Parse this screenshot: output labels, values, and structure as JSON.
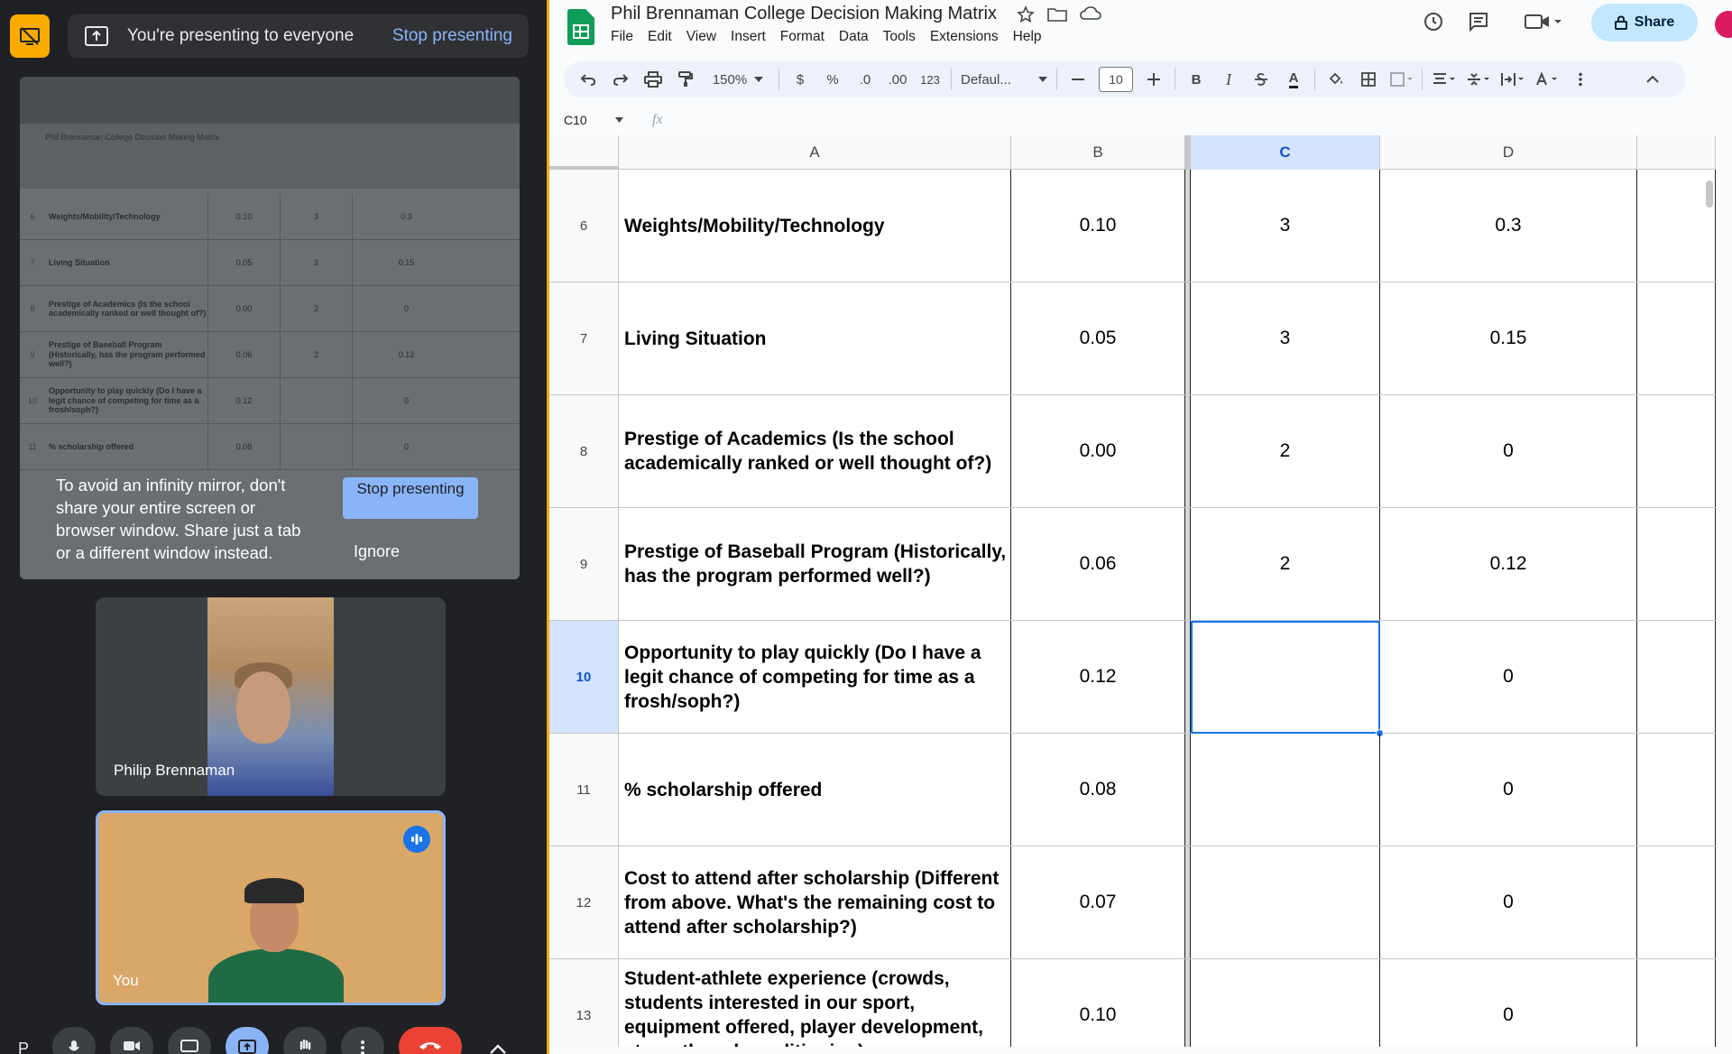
{
  "meet": {
    "banner_text": "You're presenting to everyone",
    "stop_link": "Stop presenting",
    "mirror": {
      "title": "Phil Brennaman College Decision Making Matrix",
      "rows": [
        {
          "num": "6",
          "a": "Weights/Mobility/Technology",
          "b": "0.10",
          "c": "3",
          "d": "0.3"
        },
        {
          "num": "7",
          "a": "Living Situation",
          "b": "0.05",
          "c": "3",
          "d": "0.15"
        },
        {
          "num": "8",
          "a": "Prestige of Academics (Is the school academically ranked or well thought of?)",
          "b": "0.00",
          "c": "2",
          "d": "0"
        },
        {
          "num": "9",
          "a": "Prestige of Baseball Program (Historically, has the program performed well?)",
          "b": "0.06",
          "c": "2",
          "d": "0.12"
        },
        {
          "num": "10",
          "a": "Opportunity to play quickly (Do I have a legit chance of competing for time as a frosh/soph?)",
          "b": "0.12",
          "c": "",
          "d": "0"
        },
        {
          "num": "11",
          "a": "% scholarship offered",
          "b": "0.08",
          "c": "",
          "d": "0"
        }
      ],
      "warning": "To avoid an infinity mirror, don't share your entire screen or browser window. Share just a tab or a different window instead.",
      "stop_button": "Stop presenting",
      "ignore": "Ignore"
    },
    "participants": [
      {
        "name": "Philip Brennaman"
      },
      {
        "name": "You"
      }
    ],
    "controls_initial": "P"
  },
  "sheets": {
    "title": "Phil Brennaman College Decision Making Matrix",
    "menu": [
      "File",
      "Edit",
      "View",
      "Insert",
      "Format",
      "Data",
      "Tools",
      "Extensions",
      "Help"
    ],
    "share_label": "Share",
    "toolbar": {
      "zoom": "150%",
      "currency": "$",
      "percent": "%",
      "dec_decrease": ".0",
      "dec_increase": ".00",
      "format_123": "123",
      "font": "Defaul...",
      "font_size": "10",
      "bold": "B",
      "italic": "I",
      "text_color": "A"
    },
    "name_box": "C10",
    "fx": "fx",
    "columns": [
      "A",
      "B",
      "C",
      "D"
    ],
    "selected_column": "C",
    "selected_row": "10",
    "rows": [
      {
        "num": "6",
        "a": "Weights/Mobility/Technology",
        "b": "0.10",
        "c": "3",
        "d": "0.3"
      },
      {
        "num": "7",
        "a": "Living Situation",
        "b": "0.05",
        "c": "3",
        "d": "0.15"
      },
      {
        "num": "8",
        "a": "Prestige of Academics (Is the school academically ranked or well thought of?)",
        "b": "0.00",
        "c": "2",
        "d": "0"
      },
      {
        "num": "9",
        "a": "Prestige of Baseball Program (Historically, has the program performed well?)",
        "b": "0.06",
        "c": "2",
        "d": "0.12"
      },
      {
        "num": "10",
        "a": "Opportunity to play quickly (Do I have a legit chance of competing for time as a frosh/soph?)",
        "b": "0.12",
        "c": "",
        "d": "0"
      },
      {
        "num": "11",
        "a": "% scholarship offered",
        "b": "0.08",
        "c": "",
        "d": "0"
      },
      {
        "num": "12",
        "a": "Cost to attend after scholarship (Different from above. What's the remaining cost to attend after scholarship?)",
        "b": "0.07",
        "c": "",
        "d": "0"
      },
      {
        "num": "13",
        "a": "Student-athlete experience (crowds, students interested in our sport, equipment offered, player development, strength and conditioning)",
        "b": "0.10",
        "c": "",
        "d": "0"
      }
    ]
  }
}
